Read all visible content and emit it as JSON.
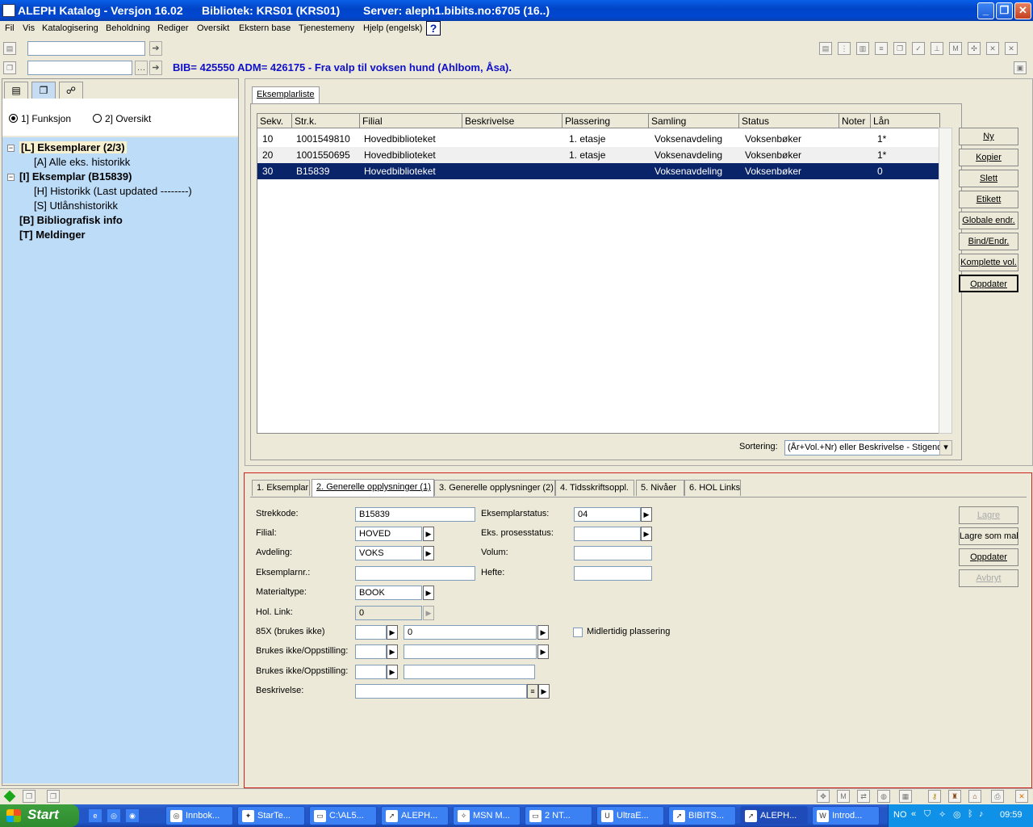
{
  "window": {
    "title": "ALEPH Katalog - Versjon 16.02",
    "library": "Bibliotek:  KRS01 (KRS01)",
    "server": "Server:  aleph1.bibits.no:6705 (16..)",
    "min": "_",
    "max": "❐",
    "close": "✕"
  },
  "menu": {
    "items": [
      "Fil",
      "Vis",
      "Katalogisering",
      "Beholdning",
      "Rediger",
      "Oversikt",
      "Ekstern base",
      "Tjenestemeny",
      "Hjelp (engelsk)"
    ],
    "help_icon": "?"
  },
  "record": {
    "bib_line": "BIB= 425550 ADM= 426175 - Fra valp til voksen hund (Ahlbom, Åsa)."
  },
  "left": {
    "radio1": "1] Funksjon",
    "radio2": "2] Oversikt",
    "tree": [
      {
        "label": "[L] Eksemplarer (2/3)"
      },
      {
        "label": "[A] Alle eks. historikk"
      },
      {
        "label": "[I] Eksemplar (B15839)"
      },
      {
        "label": "[H] Historikk (Last updated --------)"
      },
      {
        "label": "[S] Utlånshistorikk"
      },
      {
        "label": "[B] Bibliografisk info"
      },
      {
        "label": "[T] Meldinger"
      }
    ]
  },
  "items": {
    "tab": "Eksemplarliste",
    "columns": [
      "Sekv.",
      "Str.k.",
      "Filial",
      "Beskrivelse",
      "Plassering",
      "Samling",
      "Status",
      "Noter",
      "Lån"
    ],
    "rows": [
      {
        "sekv": "10",
        "strk": "1001549810",
        "filial": "Hovedbiblioteket",
        "beskrivelse": "",
        "plassering": "1. etasje",
        "samling": "Voksenavdeling",
        "status": "Voksenbøker",
        "noter": "",
        "lan": "1*"
      },
      {
        "sekv": "20",
        "strk": "1001550695",
        "filial": "Hovedbiblioteket",
        "beskrivelse": "",
        "plassering": "1. etasje",
        "samling": "Voksenavdeling",
        "status": "Voksenbøker",
        "noter": "",
        "lan": "1*"
      },
      {
        "sekv": "30",
        "strk": "B15839",
        "filial": "Hovedbiblioteket",
        "beskrivelse": "",
        "plassering": "",
        "samling": "Voksenavdeling",
        "status": "Voksenbøker",
        "noter": "",
        "lan": "0"
      }
    ],
    "buttons": [
      "Ny",
      "Kopier",
      "Slett",
      "Etikett",
      "Globale endr.",
      "Bind/Endr.",
      "Komplette vol.",
      "Oppdater"
    ],
    "sort_label": "Sortering:",
    "sort_value": "(År+Vol.+Nr) eller Beskrivelse - Stigende"
  },
  "detail": {
    "tabs": [
      "1. Eksemplar",
      "2. Generelle opplysninger (1)",
      "3. Generelle opplysninger (2)",
      "4. Tidsskriftsoppl.",
      "5. Nivåer",
      "6. HOL Links"
    ],
    "labels": {
      "strekkode": "Strekkode:",
      "filial": "Filial:",
      "avdeling": "Avdeling:",
      "eksemplarnr": "Eksemplarnr.:",
      "materialtype": "Materialtype:",
      "hol_link": "Hol. Link:",
      "f85x": "85X (brukes ikke)",
      "brukes1": "Brukes ikke/Oppstilling:",
      "brukes2": "Brukes ikke/Oppstilling:",
      "beskrivelse": "Beskrivelse:",
      "eksemplarstatus": "Eksemplarstatus:",
      "prosessstatus": "Eks. prosesstatus:",
      "volum": "Volum:",
      "hefte": "Hefte:",
      "midlertidig": "Midlertidig plassering"
    },
    "values": {
      "strekkode": "B15839",
      "filial": "HOVED",
      "avdeling": "VOKS",
      "eksemplarnr": "",
      "materialtype": "BOOK",
      "hol_link": "0",
      "f85x_a": "",
      "f85x_b": "0",
      "eksemplarstatus": "04",
      "prosessstatus": "",
      "volum": "",
      "hefte": ""
    },
    "buttons": [
      "Lagre",
      "Lagre som mal",
      "Oppdater",
      "Avbryt"
    ]
  },
  "taskbar": {
    "start": "Start",
    "tasks": [
      "Innbok...",
      "StarTe...",
      "C:\\AL5...",
      "ALEPH...",
      "MSN M...",
      "2 NT...",
      "UltraE...",
      "BIBITS...",
      "ALEPH...",
      "Introd..."
    ],
    "lang": "NO",
    "clock": "09:59"
  }
}
